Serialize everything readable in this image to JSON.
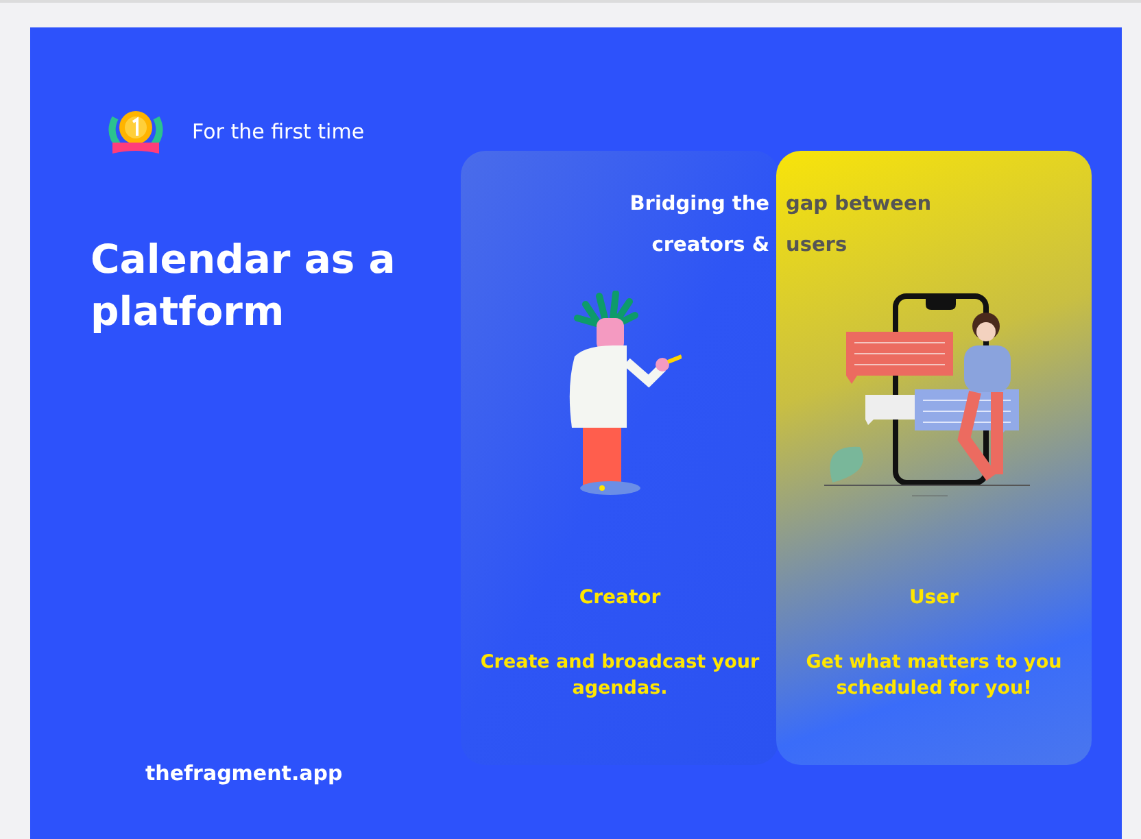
{
  "badge": {
    "text": "For the first time"
  },
  "title": "Calendar as a platform",
  "footer": "thefragment.app",
  "cards": [
    {
      "kind": "creator",
      "headline": [
        "Bridging the",
        "creators &"
      ],
      "title": "Creator",
      "description": "Create and broadcast your agendas."
    },
    {
      "kind": "user",
      "headline": [
        "gap between",
        "users"
      ],
      "title": "User",
      "description": "Get what matters to you scheduled for you!"
    }
  ]
}
